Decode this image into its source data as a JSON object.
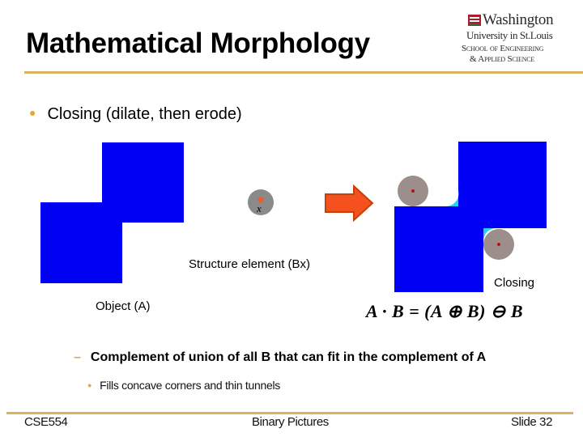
{
  "header": {
    "title": "Mathematical Morphology",
    "logo": {
      "line1": "Washington",
      "line2": "University in St.Louis",
      "line3": "School of Engineering",
      "line4": "& Applied Science"
    }
  },
  "content": {
    "bullet": "Closing (dilate, then erode)",
    "sub_bullet": "Complement of union of all B that can fit in the complement of A",
    "sub_sub_bullet": "Fills concave corners and thin tunnels"
  },
  "figure": {
    "object_label": "Object (A)",
    "structure_label": "Structure element (Bx)",
    "structure_point_label": "x",
    "result_label": "Closing",
    "formula": "A · B = (A ⊕ B) ⊖ B",
    "colors": {
      "object": "#0000f5",
      "filled_corner": "#22d3f2",
      "structure_element": "#8a8a8a",
      "structure_element_result": "#9c8e8a",
      "center_point": "#f05a28",
      "center_point_result": "#b0151a",
      "arrow": "#f4511e"
    },
    "icons": {
      "arrow": "right-arrow-icon"
    }
  },
  "footer": {
    "course": "CSE554",
    "topic": "Binary Pictures",
    "slide": "Slide 32"
  },
  "theme": {
    "accent": "#d9b65d",
    "bullet_color": "#e8a33d"
  }
}
